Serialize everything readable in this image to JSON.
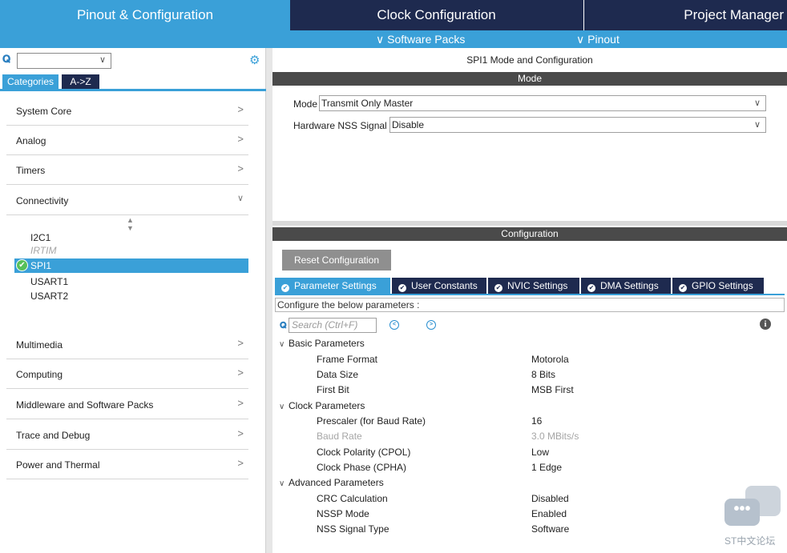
{
  "top_tabs": {
    "pinout": "Pinout & Configuration",
    "clock": "Clock Configuration",
    "project": "Project Manager"
  },
  "subbar": {
    "software_packs": "∨ Software Packs",
    "pinout": "∨ Pinout"
  },
  "left": {
    "search_value": "",
    "tabs": {
      "categories": "Categories",
      "az": "A->Z"
    },
    "categories_top": [
      {
        "label": "System Core",
        "arrow": ">"
      },
      {
        "label": "Analog",
        "arrow": ">"
      },
      {
        "label": "Timers",
        "arrow": ">"
      },
      {
        "label": "Connectivity",
        "arrow": "∨"
      }
    ],
    "connectivity_items": {
      "i2c1": "I2C1",
      "irtim": "IRTIM",
      "spi1": "SPI1",
      "usart1": "USART1",
      "usart2": "USART2"
    },
    "categories_bottom": [
      {
        "label": "Multimedia",
        "arrow": ">"
      },
      {
        "label": "Computing",
        "arrow": ">"
      },
      {
        "label": "Middleware and Software Packs",
        "arrow": ">"
      },
      {
        "label": "Trace and Debug",
        "arrow": ">"
      },
      {
        "label": "Power and Thermal",
        "arrow": ">"
      }
    ]
  },
  "right": {
    "title": "SPI1 Mode and Configuration",
    "mode_bar": "Mode",
    "mode_label": "Mode",
    "mode_value": "Transmit Only Master",
    "nss_label": "Hardware NSS Signal",
    "nss_value": "Disable",
    "config_bar": "Configuration",
    "reset_button": "Reset Configuration",
    "tabs": [
      "Parameter Settings",
      "User Constants",
      "NVIC Settings",
      "DMA Settings",
      "GPIO Settings"
    ],
    "configure_text": "Configure the below parameters :",
    "search_placeholder": "Search (Ctrl+F)",
    "groups": {
      "basic": {
        "title": "Basic Parameters",
        "params": [
          {
            "name": "Frame Format",
            "value": "Motorola"
          },
          {
            "name": "Data Size",
            "value": "8 Bits"
          },
          {
            "name": "First Bit",
            "value": "MSB First"
          }
        ]
      },
      "clock": {
        "title": "Clock Parameters",
        "params": [
          {
            "name": "Prescaler (for Baud Rate)",
            "value": "16"
          },
          {
            "name": "Baud Rate",
            "value": "3.0 MBits/s"
          },
          {
            "name": "Clock Polarity (CPOL)",
            "value": "Low"
          },
          {
            "name": "Clock Phase (CPHA)",
            "value": "1 Edge"
          }
        ]
      },
      "advanced": {
        "title": "Advanced Parameters",
        "params": [
          {
            "name": "CRC Calculation",
            "value": "Disabled"
          },
          {
            "name": "NSSP Mode",
            "value": "Enabled"
          },
          {
            "name": "NSS Signal Type",
            "value": "Software"
          }
        ]
      }
    }
  },
  "watermark": {
    "text": "ST中文论坛"
  }
}
